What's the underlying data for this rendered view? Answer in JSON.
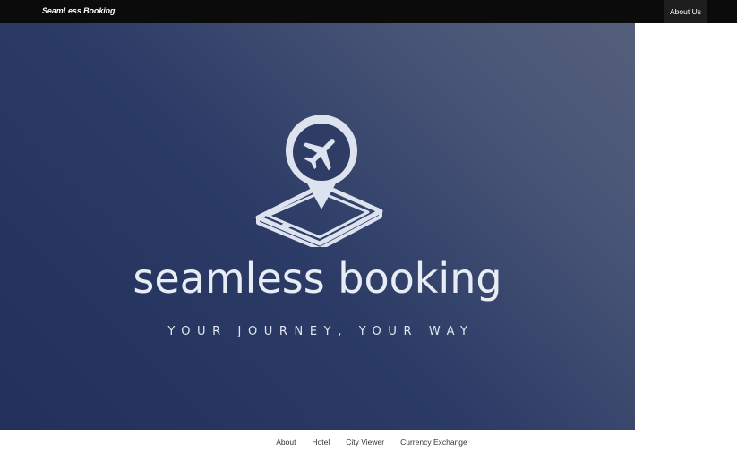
{
  "header": {
    "brand": "SeamLess Booking",
    "nav_about": "About Us"
  },
  "hero": {
    "title": "seamless booking",
    "tagline": "YOUR JOURNEY, YOUR WAY",
    "logo_icon": "airplane-location-pin-on-phone-icon",
    "gradient_colors": [
      "#22305b",
      "#545f7b"
    ]
  },
  "footer": {
    "links": [
      "About",
      "Hotel",
      "City Viewer",
      "Currency Exchange"
    ]
  }
}
